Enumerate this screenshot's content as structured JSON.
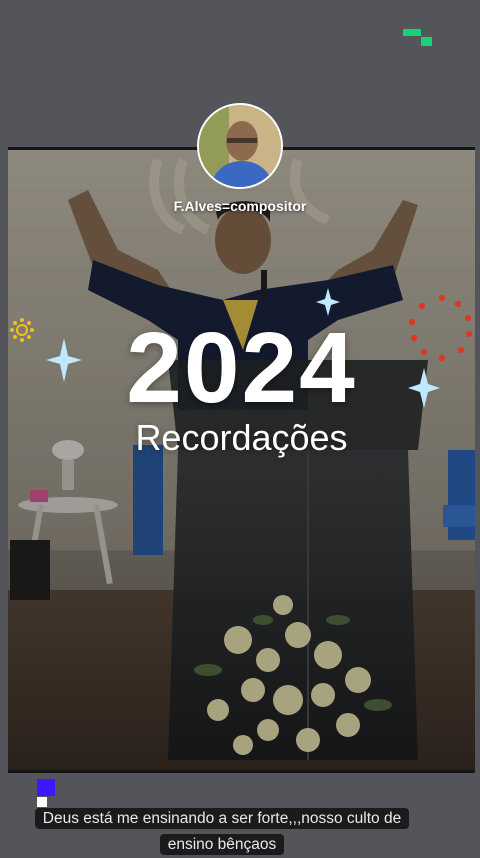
{
  "story": {
    "author_name": "F.Alves=compositor",
    "year": "2024",
    "subtitle": "Recordações",
    "caption": "Deus está me ensinando a ser forte,,,nosso culto de ensino bênçaos"
  },
  "icons": {
    "brand": "brand-mark-icon",
    "caption_marker": "caption-marker-icon",
    "sparkles": [
      "sparkle-icon",
      "sun-icon",
      "dots-ring-icon"
    ]
  },
  "colors": {
    "background": "#54555b",
    "brand_green": "#18d27a",
    "marker_blue": "#3d17ff",
    "text_white": "#ffffff"
  }
}
